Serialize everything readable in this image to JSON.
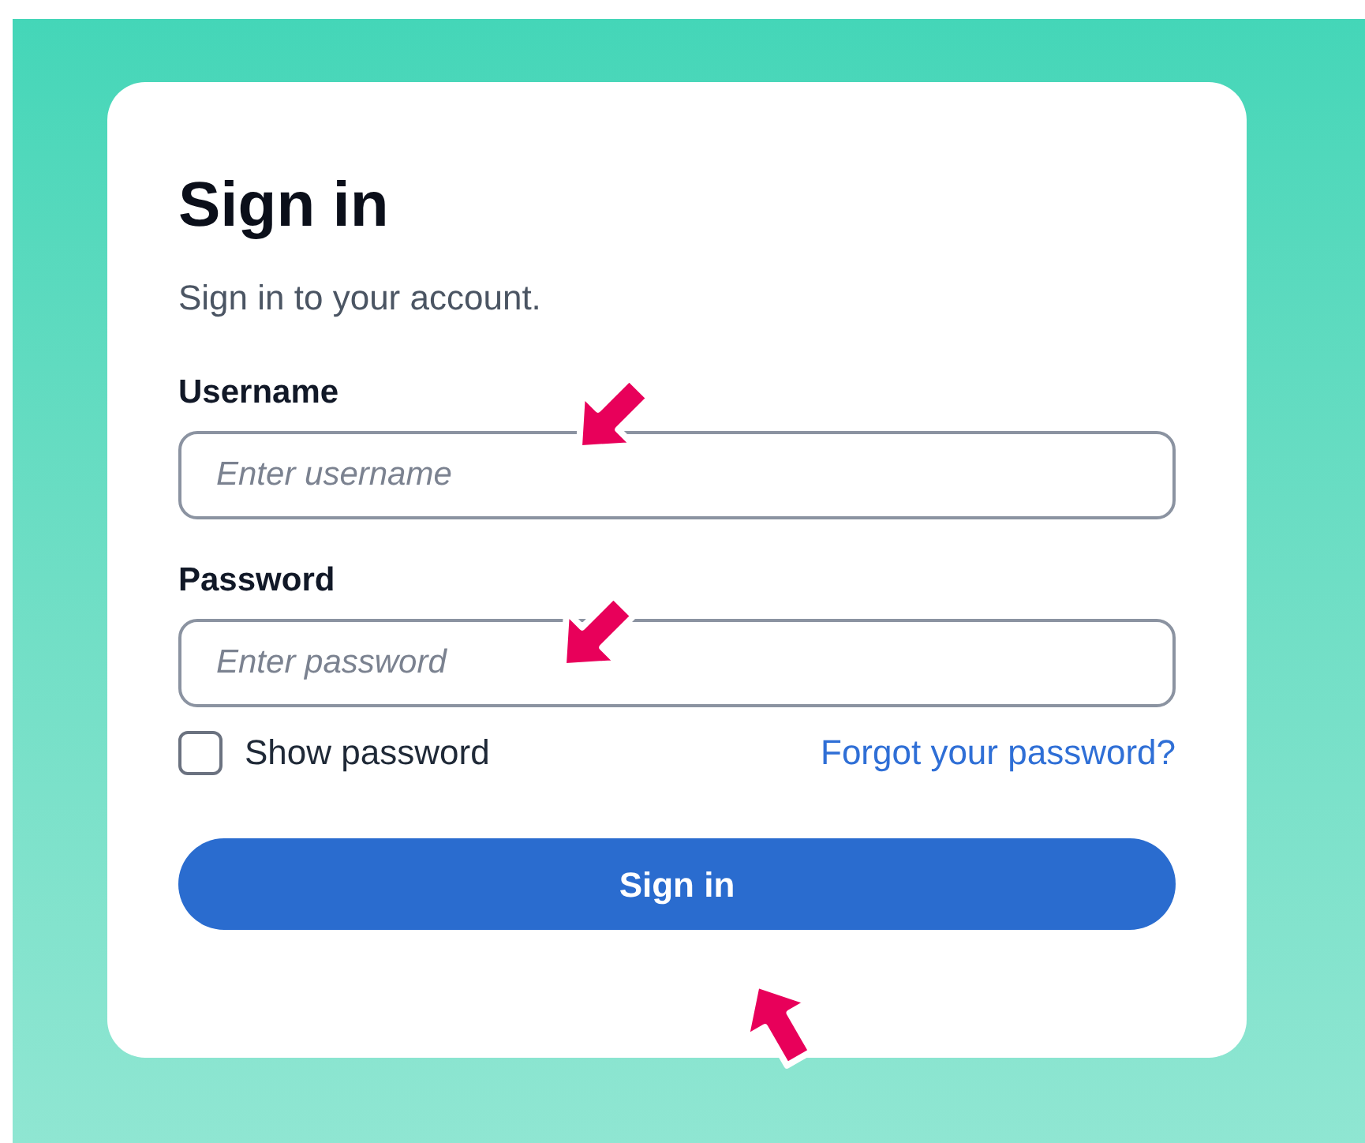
{
  "card": {
    "title": "Sign in",
    "subtitle": "Sign in to your account."
  },
  "fields": [
    {
      "label": "Username",
      "placeholder": "Enter username"
    },
    {
      "label": "Password",
      "placeholder": "Enter password"
    }
  ],
  "show_password": {
    "label": "Show password",
    "checked": false
  },
  "forgot_link": "Forgot your password?",
  "submit": "Sign in"
}
